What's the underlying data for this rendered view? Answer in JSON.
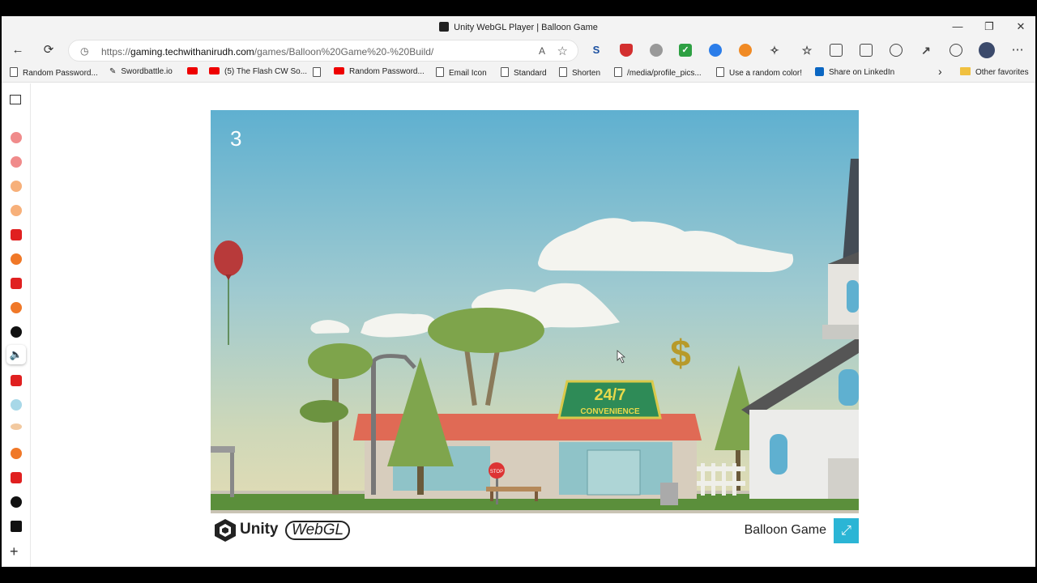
{
  "window": {
    "title": "Unity WebGL Player | Balloon Game",
    "minimize": "—",
    "restore": "❐",
    "close": "✕"
  },
  "toolbar": {
    "back_icon": "←",
    "refresh_icon": "⟳",
    "lock_icon": "🔒",
    "url_prefix": "https://",
    "url_host": "gaming.techwithanirudh.com",
    "url_path": "/games/Balloon%20Game%20-%20Build/",
    "read_aloud_icon": "A",
    "favorite_icon": "☆",
    "menu_icon": "⋯"
  },
  "bookmarks": [
    {
      "label": "Random Password...",
      "icon": "page-icon"
    },
    {
      "label": "Swordbattle.io",
      "icon": "sword-icon"
    },
    {
      "label": "",
      "icon": "youtube-icon"
    },
    {
      "label": "(5) The Flash CW So...",
      "icon": "youtube-icon"
    },
    {
      "label": "",
      "icon": "page-icon"
    },
    {
      "label": "Random Password...",
      "icon": "youtube-icon"
    },
    {
      "label": "Email Icon",
      "icon": "page-icon"
    },
    {
      "label": "Standard",
      "icon": "page-icon"
    },
    {
      "label": "Shorten",
      "icon": "page-icon"
    },
    {
      "label": "/media/profile_pics...",
      "icon": "page-icon"
    },
    {
      "label": "Use a random color!",
      "icon": "page-icon"
    },
    {
      "label": "Share on LinkedIn",
      "icon": "linkedin-icon"
    }
  ],
  "bookmarks_more": "›",
  "other_favorites": "Other favorites",
  "game": {
    "score": "3",
    "store_sign_top": "24/7",
    "store_sign_bottom": "CONVENIENCE",
    "stop_sign": "STOP",
    "coin_symbol": "$"
  },
  "footer": {
    "unity_label": "Unity",
    "webgl_label": "WebGL",
    "game_title": "Balloon Game",
    "fullscreen_icon": "⤢"
  },
  "colors": {
    "fullscreen_button": "#2bb5d5",
    "balloon": "#b83a3a",
    "roof": "#e06a55",
    "sign": "#2e8b57"
  }
}
